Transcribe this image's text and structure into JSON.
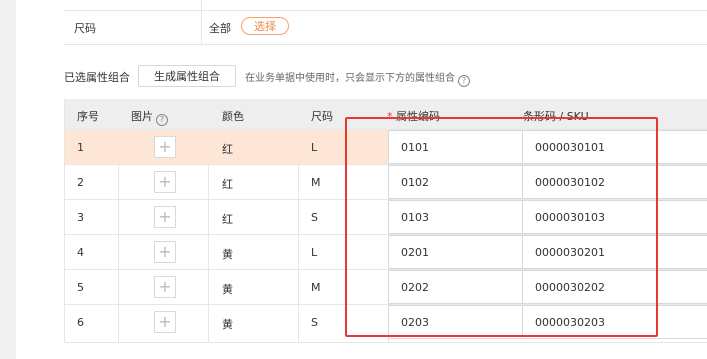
{
  "size_row": {
    "label": "尺码",
    "value": "全部",
    "select_button": "选择"
  },
  "combo": {
    "label": "已选属性组合",
    "generate_button": "生成属性组合",
    "hint": "在业务单据中使用时，只会显示下方的属性组合",
    "hint_icon": "question-icon"
  },
  "table": {
    "headers": {
      "index": "序号",
      "image": "图片",
      "color": "颜色",
      "size": "尺码",
      "attr_code": "属性编码",
      "barcode": "条形码 / SKU"
    },
    "required_mark": "*",
    "rows": [
      {
        "index": "1",
        "color": "红",
        "size": "L",
        "attr_code": "0101",
        "barcode": "0000030101"
      },
      {
        "index": "2",
        "color": "红",
        "size": "M",
        "attr_code": "0102",
        "barcode": "0000030102"
      },
      {
        "index": "3",
        "color": "红",
        "size": "S",
        "attr_code": "0103",
        "barcode": "0000030103"
      },
      {
        "index": "4",
        "color": "黄",
        "size": "L",
        "attr_code": "0201",
        "barcode": "0000030201"
      },
      {
        "index": "5",
        "color": "黄",
        "size": "M",
        "attr_code": "0202",
        "barcode": "0000030202"
      },
      {
        "index": "6",
        "color": "黄",
        "size": "S",
        "attr_code": "0203",
        "barcode": "0000030203"
      }
    ]
  },
  "colors": {
    "accent": "#f08a45",
    "highlight_row": "#fde6d6",
    "annotation_red": "#e53935"
  }
}
